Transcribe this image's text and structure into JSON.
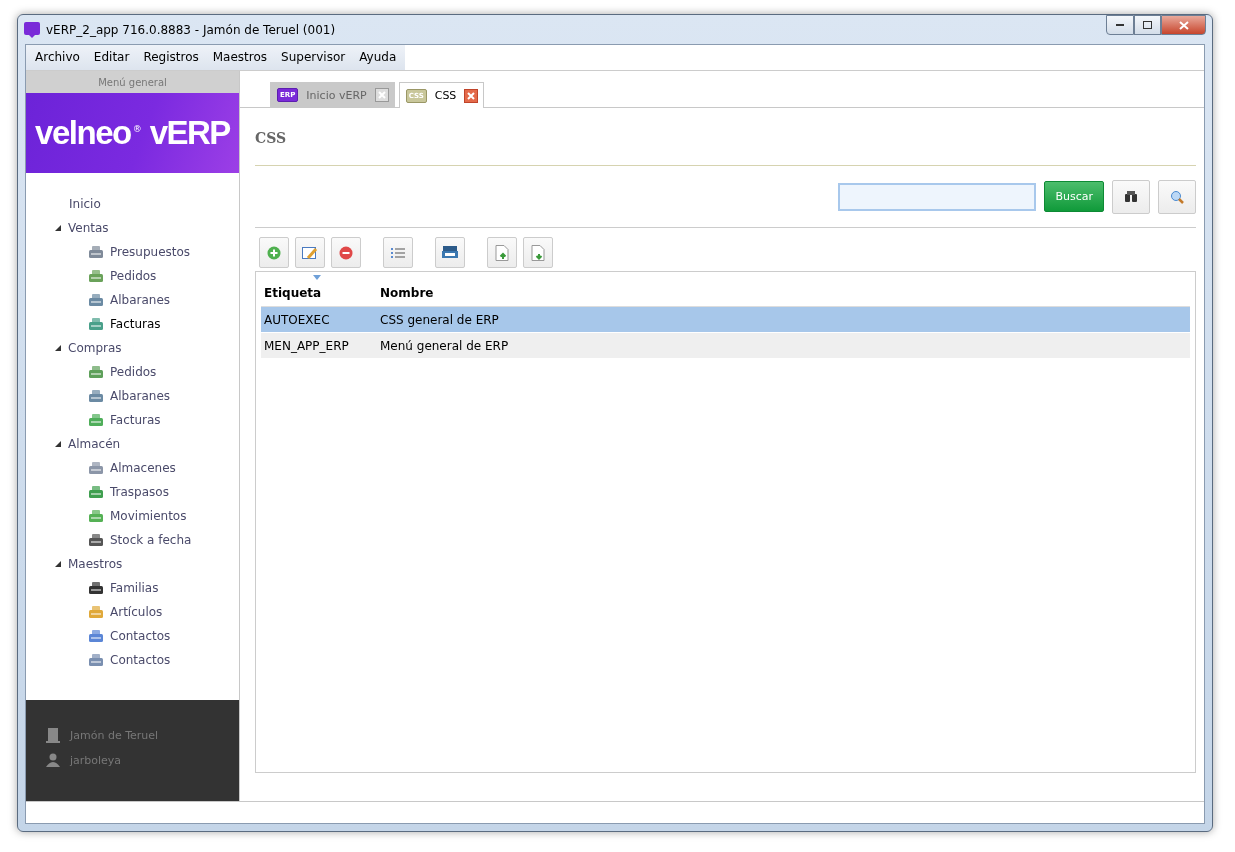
{
  "window": {
    "title": "vERP_2_app 716.0.8883 - Jamón de Teruel (001)"
  },
  "menu": [
    "Archivo",
    "Editar",
    "Registros",
    "Maestros",
    "Supervisor",
    "Ayuda"
  ],
  "sidebar": {
    "header": "Menú general",
    "logo": {
      "brand": "velneo",
      "mark": "®",
      "product": "vERP"
    },
    "tree": [
      {
        "label": "Inicio",
        "selected": false
      },
      {
        "label": "Ventas",
        "expanded": true,
        "selected": false,
        "children": [
          {
            "label": "Presupuestos",
            "selected": false
          },
          {
            "label": "Pedidos",
            "selected": false
          },
          {
            "label": "Albaranes",
            "selected": false
          },
          {
            "label": "Facturas",
            "selected": true
          }
        ]
      },
      {
        "label": "Compras",
        "expanded": true,
        "selected": false,
        "children": [
          {
            "label": "Pedidos",
            "selected": false
          },
          {
            "label": "Albaranes",
            "selected": false
          },
          {
            "label": "Facturas",
            "selected": false
          }
        ]
      },
      {
        "label": "Almacén",
        "expanded": true,
        "selected": false,
        "children": [
          {
            "label": "Almacenes",
            "selected": false
          },
          {
            "label": "Traspasos",
            "selected": false
          },
          {
            "label": "Movimientos",
            "selected": false
          },
          {
            "label": "Stock a fecha",
            "selected": false
          }
        ]
      },
      {
        "label": "Maestros",
        "expanded": true,
        "selected": false,
        "children": [
          {
            "label": "Familias",
            "selected": false
          },
          {
            "label": "Artículos",
            "selected": false
          },
          {
            "label": "Contactos",
            "selected": false
          },
          {
            "label": "Contactos",
            "selected": false
          }
        ]
      }
    ],
    "footer": {
      "company": "Jamón de Teruel",
      "user": "jarboleya"
    }
  },
  "tabs": [
    {
      "label": "Inicio vERP",
      "badge": "ERP",
      "selected": false
    },
    {
      "label": "CSS",
      "badge": "CSS",
      "selected": true
    }
  ],
  "page_title": "CSS",
  "search": {
    "button": "Buscar"
  },
  "table": {
    "columns": [
      {
        "label": "Etiqueta",
        "sorted": true
      },
      {
        "label": "Nombre",
        "sorted": false
      }
    ],
    "rows": [
      {
        "cells": [
          "AUTOEXEC",
          "CSS general de ERP"
        ],
        "selected": true
      },
      {
        "cells": [
          "MEN_APP_ERP",
          "Menú general de ERP"
        ],
        "selected": false
      }
    ]
  }
}
